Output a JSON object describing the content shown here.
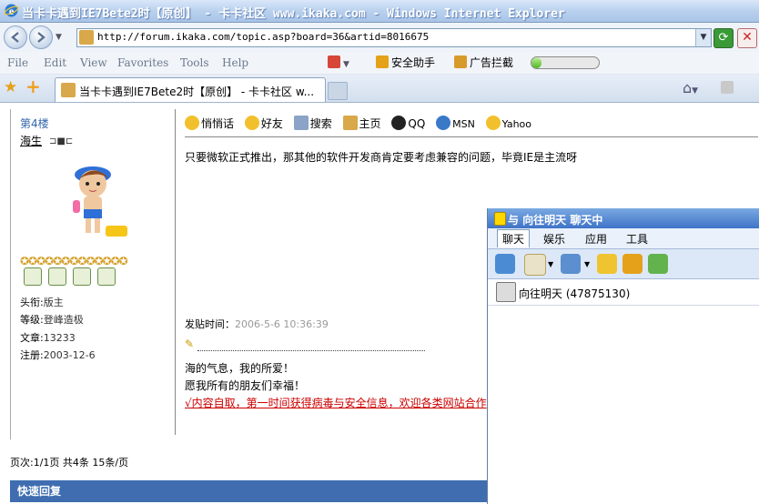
{
  "window": {
    "title": "当卡卡遇到IE7Bete2时【原创】 - 卡卡社区 www.ikaka.com - Windows Internet Explorer"
  },
  "address_bar": {
    "url": "http://forum.ikaka.com/topic.asp?board=36&artid=8016675"
  },
  "menu": {
    "file": "File",
    "edit": "Edit",
    "view": "View",
    "favorites": "Favorites",
    "tools": "Tools",
    "help": "Help"
  },
  "toolbar": {
    "security_helper": "安全助手",
    "ad_block": "广告拦截",
    "progress_fraction": 0.15
  },
  "tab": {
    "title": "当卡卡遇到IE7Bete2时【原创】 - 卡卡社区 w..."
  },
  "post": {
    "floor": "第4楼",
    "author": "海生",
    "author_badge": "⊐■⊏",
    "stars": "✪✪✪✪✪✪✪✪✪✪✪✪✪",
    "info": [
      {
        "key": "头衔:",
        "value": "版主"
      },
      {
        "key": "等级:",
        "value": "登峰造极"
      },
      {
        "key": "文章:",
        "value": "13233"
      },
      {
        "key": "注册:",
        "value": "2003-12-6"
      }
    ],
    "actions": {
      "whisper": "悄悄话",
      "friend": "好友",
      "search": "搜索",
      "homepage": "主页",
      "qq": "QQ",
      "msn": "MSN",
      "yahoo": "Yahoo"
    },
    "body": "只要微软正式推出，那其他的软件开发商肯定要考虑兼容的问题，毕竟IE是主流呀",
    "time_label": "发贴时间：",
    "time_value": "2006-5-6 10:36:39",
    "signature_line1": "海的气息，我的所爱！",
    "signature_line2": "愿我所有的朋友们幸福！",
    "signature_link": "√内容自取，第一时间获得病毒与安全信息，欢迎各类网站合作"
  },
  "footer": {
    "pagination": "页次:1/1页 共4条 15条/页",
    "quick_reply": "快速回复"
  },
  "chat": {
    "title": "与 向往明天 聊天中",
    "tabs": [
      "聊天",
      "娱乐",
      "应用",
      "工具"
    ],
    "contact": "向往明天 (47875130)"
  },
  "colors": {
    "titlebar_text": "#ffffff",
    "link_red": "#cc0000",
    "floor_blue": "#3366aa",
    "quick_reply_bg": "#3f6db0"
  }
}
